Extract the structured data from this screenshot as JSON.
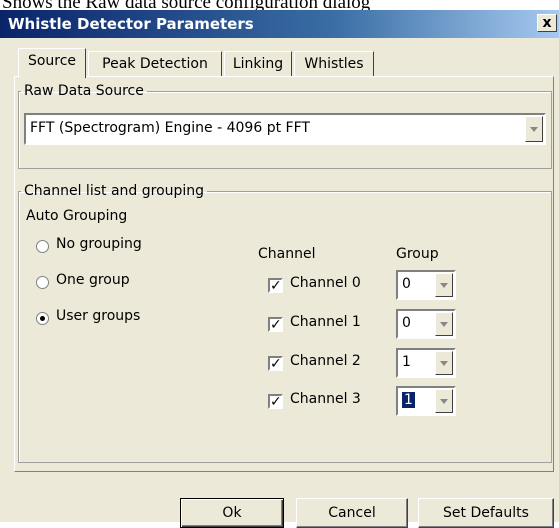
{
  "backdrop": {
    "text": "Shows the Raw data source configuration dialog"
  },
  "window": {
    "title": "Whistle Detector Parameters",
    "close_glyph": "x"
  },
  "tabs": [
    {
      "label": "Source"
    },
    {
      "label": "Peak Detection"
    },
    {
      "label": "Linking"
    },
    {
      "label": "Whistles"
    }
  ],
  "raw_data_source": {
    "legend": "Raw Data Source",
    "selected": "FFT (Spectrogram) Engine - 4096 pt FFT"
  },
  "channels": {
    "legend": "Channel list and grouping",
    "auto_grouping_label": "Auto Grouping",
    "options": [
      {
        "label": "No grouping",
        "checked": false
      },
      {
        "label": "One group",
        "checked": false
      },
      {
        "label": "User groups",
        "checked": true
      }
    ],
    "col_channel": "Channel",
    "col_group": "Group",
    "rows": [
      {
        "label": "Channel 0",
        "checked": true,
        "group": "0"
      },
      {
        "label": "Channel 1",
        "checked": true,
        "group": "0"
      },
      {
        "label": "Channel 2",
        "checked": true,
        "group": "1"
      },
      {
        "label": "Channel 3",
        "checked": true,
        "group": "1"
      }
    ]
  },
  "buttons": {
    "ok": "Ok",
    "cancel": "Cancel",
    "defaults": "Set Defaults"
  },
  "colors": {
    "dialog_bg": "#ece9d8",
    "title_start": "#0a246a",
    "title_end": "#a6caf0",
    "selection": "#0a246a"
  }
}
